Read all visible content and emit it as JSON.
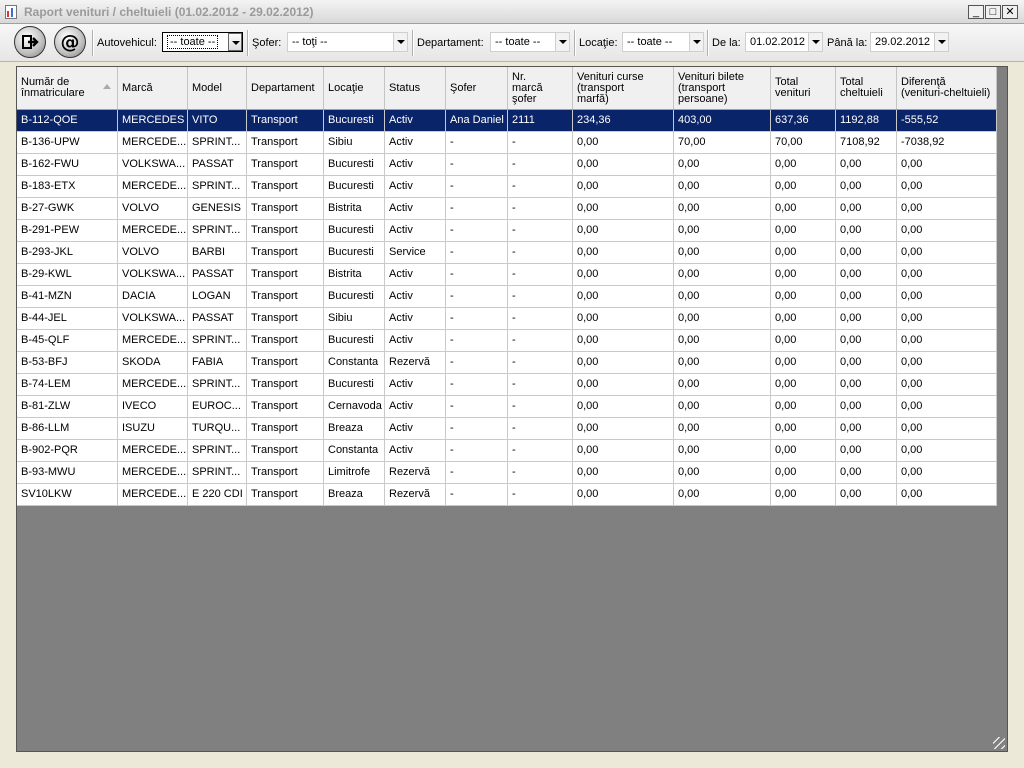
{
  "window": {
    "title": "Raport venituri / cheltuieli (01.02.2012 - 29.02.2012)",
    "minimize": "_",
    "maximize": "□",
    "close": "✕"
  },
  "toolbar": {
    "exit_icon": "exit-arrow-icon",
    "email_icon": "at-email-icon",
    "autovehicul": {
      "label": "Autovehicul:",
      "value": "-- toate --"
    },
    "sofer": {
      "label": "Şofer:",
      "value": "-- toţi --"
    },
    "departament": {
      "label": "Departament:",
      "value": "-- toate --"
    },
    "locatie": {
      "label": "Locaţie:",
      "value": "-- toate --"
    },
    "de_la": {
      "label": "De la:",
      "value": "01.02.2012"
    },
    "pana_la": {
      "label": "Până la:",
      "value": "29.02.2012"
    }
  },
  "table": {
    "columns": [
      "Număr de\nînmatriculare",
      "Marcă",
      "Model",
      "Departament",
      "Locaţie",
      "Status",
      "Şofer",
      "Nr.\nmarcă\nşofer",
      "Venituri curse\n(transport\nmarfă)",
      "Venituri bilete\n(transport\npersoane)",
      "Total\nvenituri",
      "Total\ncheltuieli",
      "Diferenţă\n(venituri-cheltuieli)"
    ],
    "rows": [
      [
        "B-112-QOE",
        "MERCEDES",
        "VITO",
        "Transport",
        "Bucuresti",
        "Activ",
        "Ana Daniel",
        "2111",
        "234,36",
        "403,00",
        "637,36",
        "1192,88",
        "-555,52"
      ],
      [
        "B-136-UPW",
        "MERCEDE...",
        "SPRINT...",
        "Transport",
        "Sibiu",
        "Activ",
        "-",
        "-",
        "0,00",
        "70,00",
        "70,00",
        "7108,92",
        "-7038,92"
      ],
      [
        "B-162-FWU",
        "VOLKSWA...",
        "PASSAT",
        "Transport",
        "Bucuresti",
        "Activ",
        "-",
        "-",
        "0,00",
        "0,00",
        "0,00",
        "0,00",
        "0,00"
      ],
      [
        "B-183-ETX",
        "MERCEDE...",
        "SPRINT...",
        "Transport",
        "Bucuresti",
        "Activ",
        "-",
        "-",
        "0,00",
        "0,00",
        "0,00",
        "0,00",
        "0,00"
      ],
      [
        "B-27-GWK",
        "VOLVO",
        "GENESIS",
        "Transport",
        "Bistrita",
        "Activ",
        "-",
        "-",
        "0,00",
        "0,00",
        "0,00",
        "0,00",
        "0,00"
      ],
      [
        "B-291-PEW",
        "MERCEDE...",
        "SPRINT...",
        "Transport",
        "Bucuresti",
        "Activ",
        "-",
        "-",
        "0,00",
        "0,00",
        "0,00",
        "0,00",
        "0,00"
      ],
      [
        "B-293-JKL",
        "VOLVO",
        "BARBI",
        "Transport",
        "Bucuresti",
        "Service",
        "-",
        "-",
        "0,00",
        "0,00",
        "0,00",
        "0,00",
        "0,00"
      ],
      [
        "B-29-KWL",
        "VOLKSWA...",
        "PASSAT",
        "Transport",
        "Bistrita",
        "Activ",
        "-",
        "-",
        "0,00",
        "0,00",
        "0,00",
        "0,00",
        "0,00"
      ],
      [
        "B-41-MZN",
        "DACIA",
        "LOGAN",
        "Transport",
        "Bucuresti",
        "Activ",
        "-",
        "-",
        "0,00",
        "0,00",
        "0,00",
        "0,00",
        "0,00"
      ],
      [
        "B-44-JEL",
        "VOLKSWA...",
        "PASSAT",
        "Transport",
        "Sibiu",
        "Activ",
        "-",
        "-",
        "0,00",
        "0,00",
        "0,00",
        "0,00",
        "0,00"
      ],
      [
        "B-45-QLF",
        "MERCEDE...",
        "SPRINT...",
        "Transport",
        "Bucuresti",
        "Activ",
        "-",
        "-",
        "0,00",
        "0,00",
        "0,00",
        "0,00",
        "0,00"
      ],
      [
        "B-53-BFJ",
        "SKODA",
        "FABIA",
        "Transport",
        "Constanta",
        "Rezervă",
        "-",
        "-",
        "0,00",
        "0,00",
        "0,00",
        "0,00",
        "0,00"
      ],
      [
        "B-74-LEM",
        "MERCEDE...",
        "SPRINT...",
        "Transport",
        "Bucuresti",
        "Activ",
        "-",
        "-",
        "0,00",
        "0,00",
        "0,00",
        "0,00",
        "0,00"
      ],
      [
        "B-81-ZLW",
        "IVECO",
        "EUROC...",
        "Transport",
        "Cernavoda",
        "Activ",
        "-",
        "-",
        "0,00",
        "0,00",
        "0,00",
        "0,00",
        "0,00"
      ],
      [
        "B-86-LLM",
        "ISUZU",
        "TURQU...",
        "Transport",
        "Breaza",
        "Activ",
        "-",
        "-",
        "0,00",
        "0,00",
        "0,00",
        "0,00",
        "0,00"
      ],
      [
        "B-902-PQR",
        "MERCEDE...",
        "SPRINT...",
        "Transport",
        "Constanta",
        "Activ",
        "-",
        "-",
        "0,00",
        "0,00",
        "0,00",
        "0,00",
        "0,00"
      ],
      [
        "B-93-MWU",
        "MERCEDE...",
        "SPRINT...",
        "Transport",
        "Limitrofe",
        "Rezervă",
        "-",
        "-",
        "0,00",
        "0,00",
        "0,00",
        "0,00",
        "0,00"
      ],
      [
        "SV10LKW",
        "MERCEDE...",
        "E 220 CDI",
        "Transport",
        "Breaza",
        "Rezervă",
        "-",
        "-",
        "0,00",
        "0,00",
        "0,00",
        "0,00",
        "0,00"
      ]
    ],
    "selected_row": 0,
    "sort_icon": "sort-ascending-icon",
    "colors": {
      "selection": "#0a246a",
      "empty_area": "#808080"
    }
  }
}
